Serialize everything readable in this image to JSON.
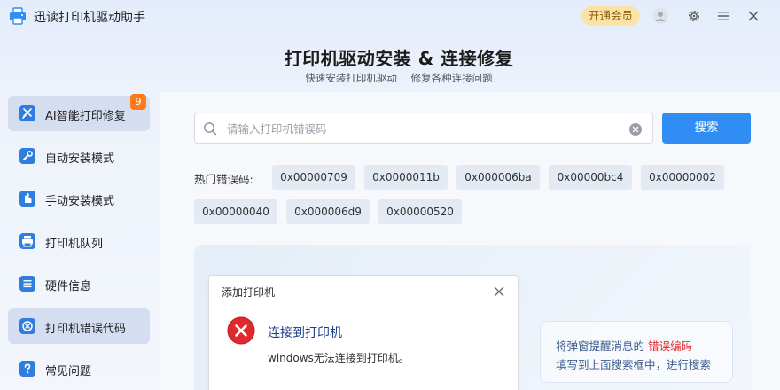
{
  "app": {
    "title": "迅读打印机驱动助手",
    "logo_icon": "printer-logo-icon",
    "vip_label": "开通会员"
  },
  "window_controls": [
    "avatar-icon",
    "gear-icon",
    "menu-icon",
    "close-icon"
  ],
  "header": {
    "title": "打印机驱动安装 & 连接修复",
    "subtitle": "快速安装打印机驱动 修复各种连接问题"
  },
  "sidebar": {
    "items": [
      {
        "label": "AI智能打印修复",
        "icon": "ai-repair-icon",
        "badge": "9",
        "active": true
      },
      {
        "label": "自动安装模式",
        "icon": "wrench-icon",
        "active": false
      },
      {
        "label": "手动安装模式",
        "icon": "hand-icon",
        "active": false
      },
      {
        "label": "打印机队列",
        "icon": "printer-icon",
        "active": false
      },
      {
        "label": "硬件信息",
        "icon": "list-icon",
        "active": false
      },
      {
        "label": "打印机错误代码",
        "icon": "error-code-icon",
        "active": true
      },
      {
        "label": "常见问题",
        "icon": "question-icon",
        "active": false
      }
    ]
  },
  "search": {
    "placeholder": "请输入打印机错误码",
    "value": "",
    "button_label": "搜索"
  },
  "hot_codes": {
    "label": "热门错误码:",
    "codes": [
      "0x00000709",
      "0x0000011b",
      "0x000006ba",
      "0x00000bc4",
      "0x00000002",
      "0x00000040",
      "0x000006d9",
      "0x00000520"
    ]
  },
  "example": {
    "dialog_title": "添加打印机",
    "heading": "连接到打印机",
    "message": "windows无法连接到打印机。",
    "tip_line1_prefix": "将弹窗提醒消息的 ",
    "tip_line1_highlight": "错误编码",
    "tip_line2": "填写到上面搜索框中，进行搜索"
  },
  "colors": {
    "accent": "#2f8df3",
    "badge": "#ff7a1a",
    "error": "#e0282e",
    "vip_bg": "#fbe3a6"
  }
}
